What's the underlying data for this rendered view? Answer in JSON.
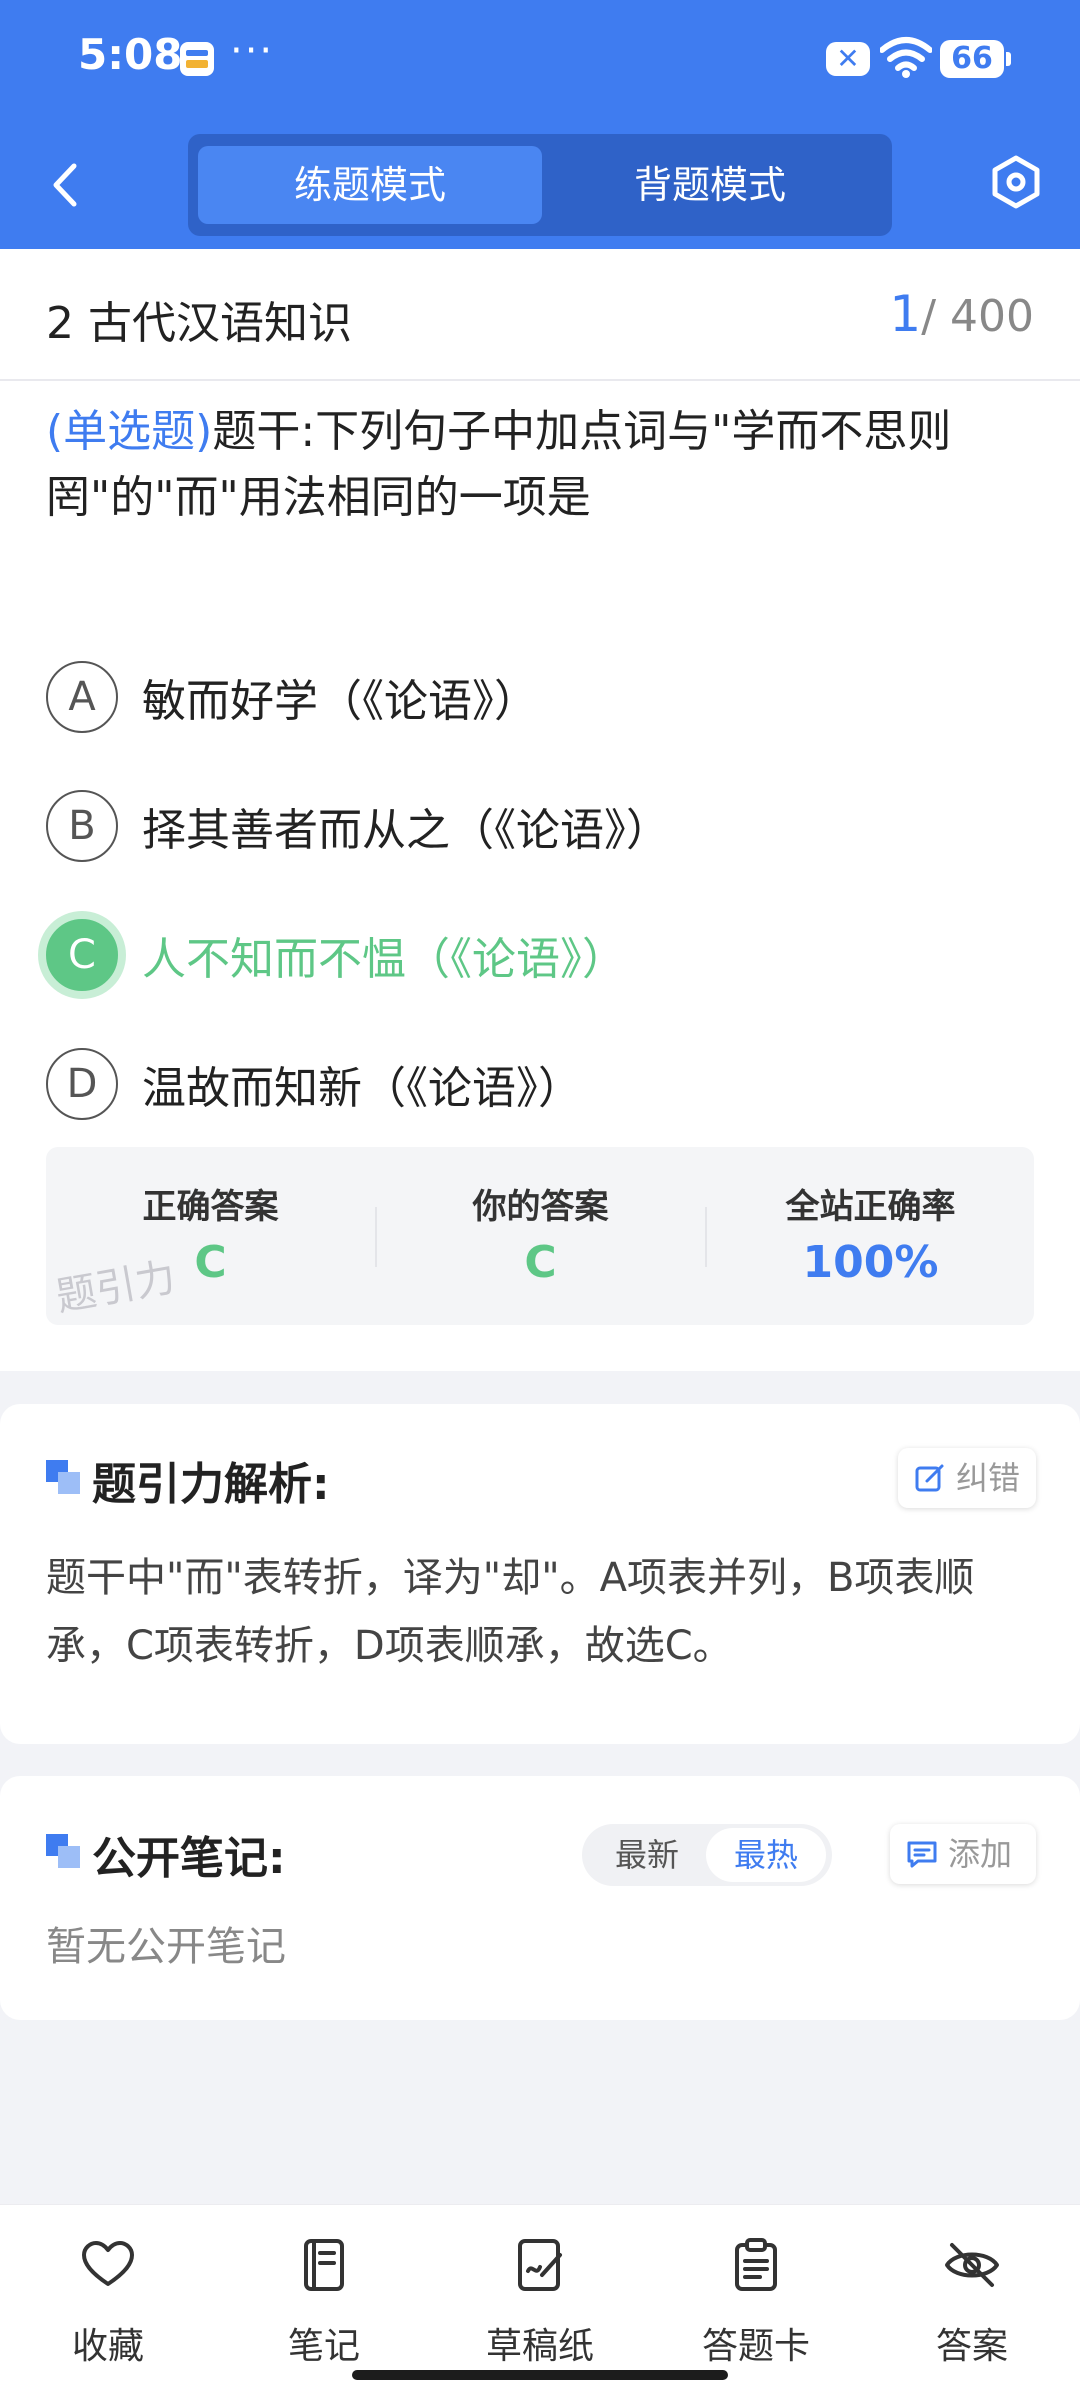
{
  "status_bar": {
    "time": "5:08",
    "dots": "···",
    "battery": "66"
  },
  "header": {
    "tabs": [
      {
        "label": "练题模式",
        "active": true
      },
      {
        "label": "背题模式",
        "active": false
      }
    ]
  },
  "question": {
    "chapter": "2 古代汉语知识",
    "current": "1",
    "total": "/ 400",
    "type": "(单选题)",
    "stem": "题干:下列句子中加点词与\"学而不思则罔\"的\"而\"用法相同的一项是",
    "options": [
      {
        "letter": "A",
        "text": "敏而好学（《论语》）"
      },
      {
        "letter": "B",
        "text": "择其善者而从之（《论语》）"
      },
      {
        "letter": "C",
        "text": "人不知而不愠（《论语》）",
        "state": "correct"
      },
      {
        "letter": "D",
        "text": "温故而知新（《论语》）"
      }
    ]
  },
  "answer_summary": {
    "correct_label": "正确答案",
    "correct_value": "C",
    "yours_label": "你的答案",
    "yours_value": "C",
    "rate_label": "全站正确率",
    "rate_value": "100%",
    "watermark": "题引力"
  },
  "analysis": {
    "title": "题引力解析:",
    "report_label": "纠错",
    "text": "题干中\"而\"表转折，译为\"却\"。A项表并列，B项表顺承，C项表转折，D项表顺承，故选C。"
  },
  "notes": {
    "title": "公开笔记:",
    "sort_new": "最新",
    "sort_hot": "最热",
    "add_label": "添加",
    "empty": "暂无公开笔记"
  },
  "bottom_bar": [
    {
      "label": "收藏",
      "icon": "heart-icon"
    },
    {
      "label": "笔记",
      "icon": "notebook-icon"
    },
    {
      "label": "草稿纸",
      "icon": "draft-icon"
    },
    {
      "label": "答题卡",
      "icon": "clipboard-icon"
    },
    {
      "label": "答案",
      "icon": "eye-off-icon"
    }
  ],
  "colors": {
    "accent": "#3f7cf0",
    "correct": "#5ec786"
  }
}
